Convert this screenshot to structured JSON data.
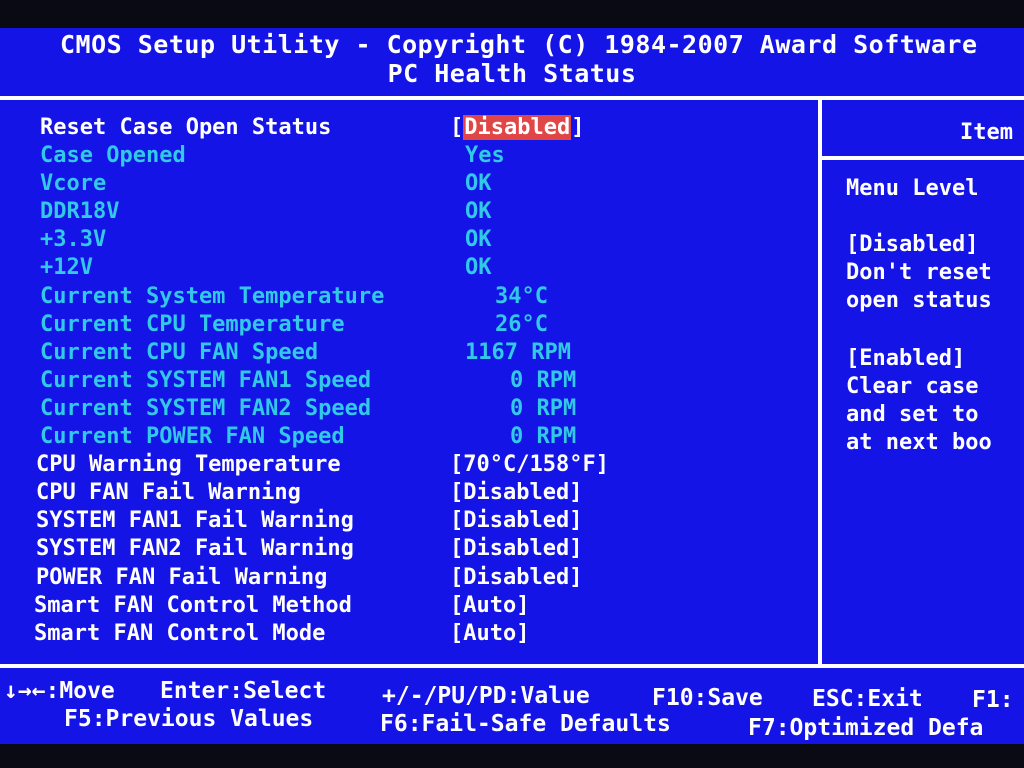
{
  "header": {
    "title": "CMOS Setup Utility - Copyright (C) 1984-2007 Award Software",
    "subtitle": "PC Health Status"
  },
  "settings": [
    {
      "label": "Reset Case Open Status",
      "value": "Disabled",
      "editable": true,
      "selected": true
    },
    {
      "label": "Case Opened",
      "value": "Yes",
      "editable": false
    },
    {
      "label": "Vcore",
      "value": "OK",
      "editable": false
    },
    {
      "label": "DDR18V",
      "value": "OK",
      "editable": false
    },
    {
      "label": "+3.3V",
      "value": "OK",
      "editable": false
    },
    {
      "label": "+12V",
      "value": "OK",
      "editable": false
    },
    {
      "label": "Current System Temperature",
      "value": "34°C",
      "editable": false
    },
    {
      "label": "Current CPU Temperature",
      "value": "26°C",
      "editable": false
    },
    {
      "label": "Current CPU FAN Speed",
      "value": "1167 RPM",
      "editable": false
    },
    {
      "label": "Current SYSTEM FAN1 Speed",
      "value": "0 RPM",
      "editable": false
    },
    {
      "label": "Current SYSTEM FAN2 Speed",
      "value": "0 RPM",
      "editable": false
    },
    {
      "label": "Current POWER FAN Speed",
      "value": "0 RPM",
      "editable": false
    },
    {
      "label": "CPU Warning Temperature",
      "value": "[70°C/158°F]",
      "editable": true
    },
    {
      "label": "CPU FAN Fail Warning",
      "value": "[Disabled]",
      "editable": true
    },
    {
      "label": "SYSTEM FAN1 Fail Warning",
      "value": "[Disabled]",
      "editable": true
    },
    {
      "label": "SYSTEM FAN2 Fail Warning",
      "value": "[Disabled]",
      "editable": true
    },
    {
      "label": "POWER FAN Fail Warning",
      "value": "[Disabled]",
      "editable": true
    },
    {
      "label": "Smart FAN Control Method",
      "value": "[Auto]",
      "editable": true
    },
    {
      "label": "Smart FAN Control Mode",
      "value": "[Auto]",
      "editable": true
    }
  ],
  "help_panel": {
    "header": "Item",
    "menu_level": "Menu Level",
    "lines": [
      "[Disabled]",
      "Don't reset",
      "open status",
      "",
      "[Enabled]",
      "Clear case",
      "and set to",
      "at next boo"
    ]
  },
  "footer": {
    "keys": [
      {
        "text": "↓→←:Move"
      },
      {
        "text": "Enter:Select"
      },
      {
        "text": "+/-/PU/PD:Value"
      },
      {
        "text": "F10:Save"
      },
      {
        "text": "ESC:Exit"
      },
      {
        "text": "F1:"
      },
      {
        "text": "F5:Previous Values"
      },
      {
        "text": "F6:Fail-Safe Defaults"
      },
      {
        "text": "F7:Optimized Defa"
      }
    ]
  },
  "colors": {
    "background": "#1414e6",
    "info_text": "#32c8e8",
    "editable_text": "#ffffff",
    "selection": "#e04646"
  }
}
